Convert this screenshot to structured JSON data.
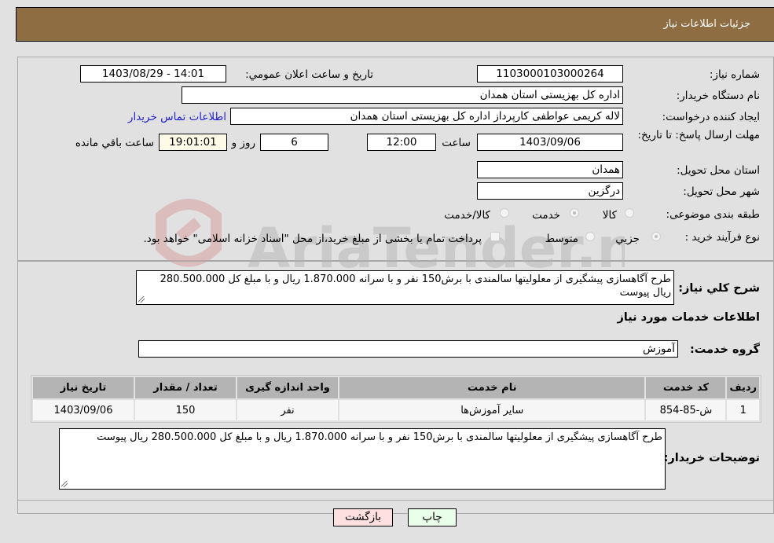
{
  "header": {
    "title": "جزئيات اطلاعات نياز"
  },
  "fields": {
    "need_number_label": "شماره نياز:",
    "need_number": "1103000103000264",
    "announce_label": "تاريخ و ساعت اعلان عمومي:",
    "announce_value": "1403/08/29 - 14:01",
    "buyer_org_label": "نام دستگاه خريدار:",
    "buyer_org": "اداره کل بهزيستی استان همدان",
    "creator_label": "ايجاد کننده درخواست:",
    "creator": "لاله کريمی عواطفی کارپرداز اداره کل بهزيستی استان همدان",
    "contact_link": "اطلاعات تماس خريدار",
    "deadline_label": "مهلت ارسال پاسخ: تا تاريخ:",
    "deadline_date": "1403/09/06",
    "time_label": "ساعت",
    "deadline_time": "12:00",
    "days_value": "6",
    "days_label": "روز و",
    "remaining_time": "19:01:01",
    "remaining_label": "ساعت باقي مانده",
    "province_label": "استان محل تحويل:",
    "province": "همدان",
    "city_label": "شهر محل تحويل:",
    "city": "درگزين",
    "category_label": "طبقه بندی موضوعی:",
    "category_options": [
      "کالا",
      "خدمت",
      "کالا/خدمت"
    ],
    "category_selected": "خدمت",
    "process_label": "نوع فرآيند خريد :",
    "process_options": [
      "جزيي",
      "متوسط"
    ],
    "process_selected": "جزيي",
    "treasury_note": "پرداخت تمام يا بخشی از مبلغ خريد،از محل \"اسناد خزانه اسلامی\" خواهد بود."
  },
  "description": {
    "label": "شرح كلي نياز:",
    "text": "طرح آگاهسازی پيشگيری از معلوليتها سالمندی با برش150 نفر و با سرانه 1.870.000 ريال و با مبلغ كل 280.500.000 ريال پيوست"
  },
  "services": {
    "section_title": "اطلاعات خدمات مورد نياز",
    "group_label": "گروه خدمت:",
    "group_value": "آموزش",
    "columns": [
      "رديف",
      "كد خدمت",
      "نام خدمت",
      "واحد اندازه گيری",
      "تعداد / مقدار",
      "تاريخ نياز"
    ],
    "rows": [
      {
        "row": "1",
        "code": "ش-85-854",
        "name": "ساير آموزش‌ها",
        "unit": "نفر",
        "qty": "150",
        "date": "1403/09/06"
      }
    ]
  },
  "buyer_notes": {
    "label": "توضيحات خريدار:",
    "text": "طرح آگاهسازی پيشگيری از معلوليتها سالمندی با برش150 نفر و با سرانه 1.870.000 ريال و با مبلغ كل 280.500.000 ريال پيوست"
  },
  "buttons": {
    "print": "چاپ",
    "back": "بازگشت"
  },
  "colors": {
    "header_bg": "#8e6d43",
    "print_bg": "#eaffea",
    "back_bg": "#ffe0e0"
  },
  "watermark": "AriaTender.neT"
}
